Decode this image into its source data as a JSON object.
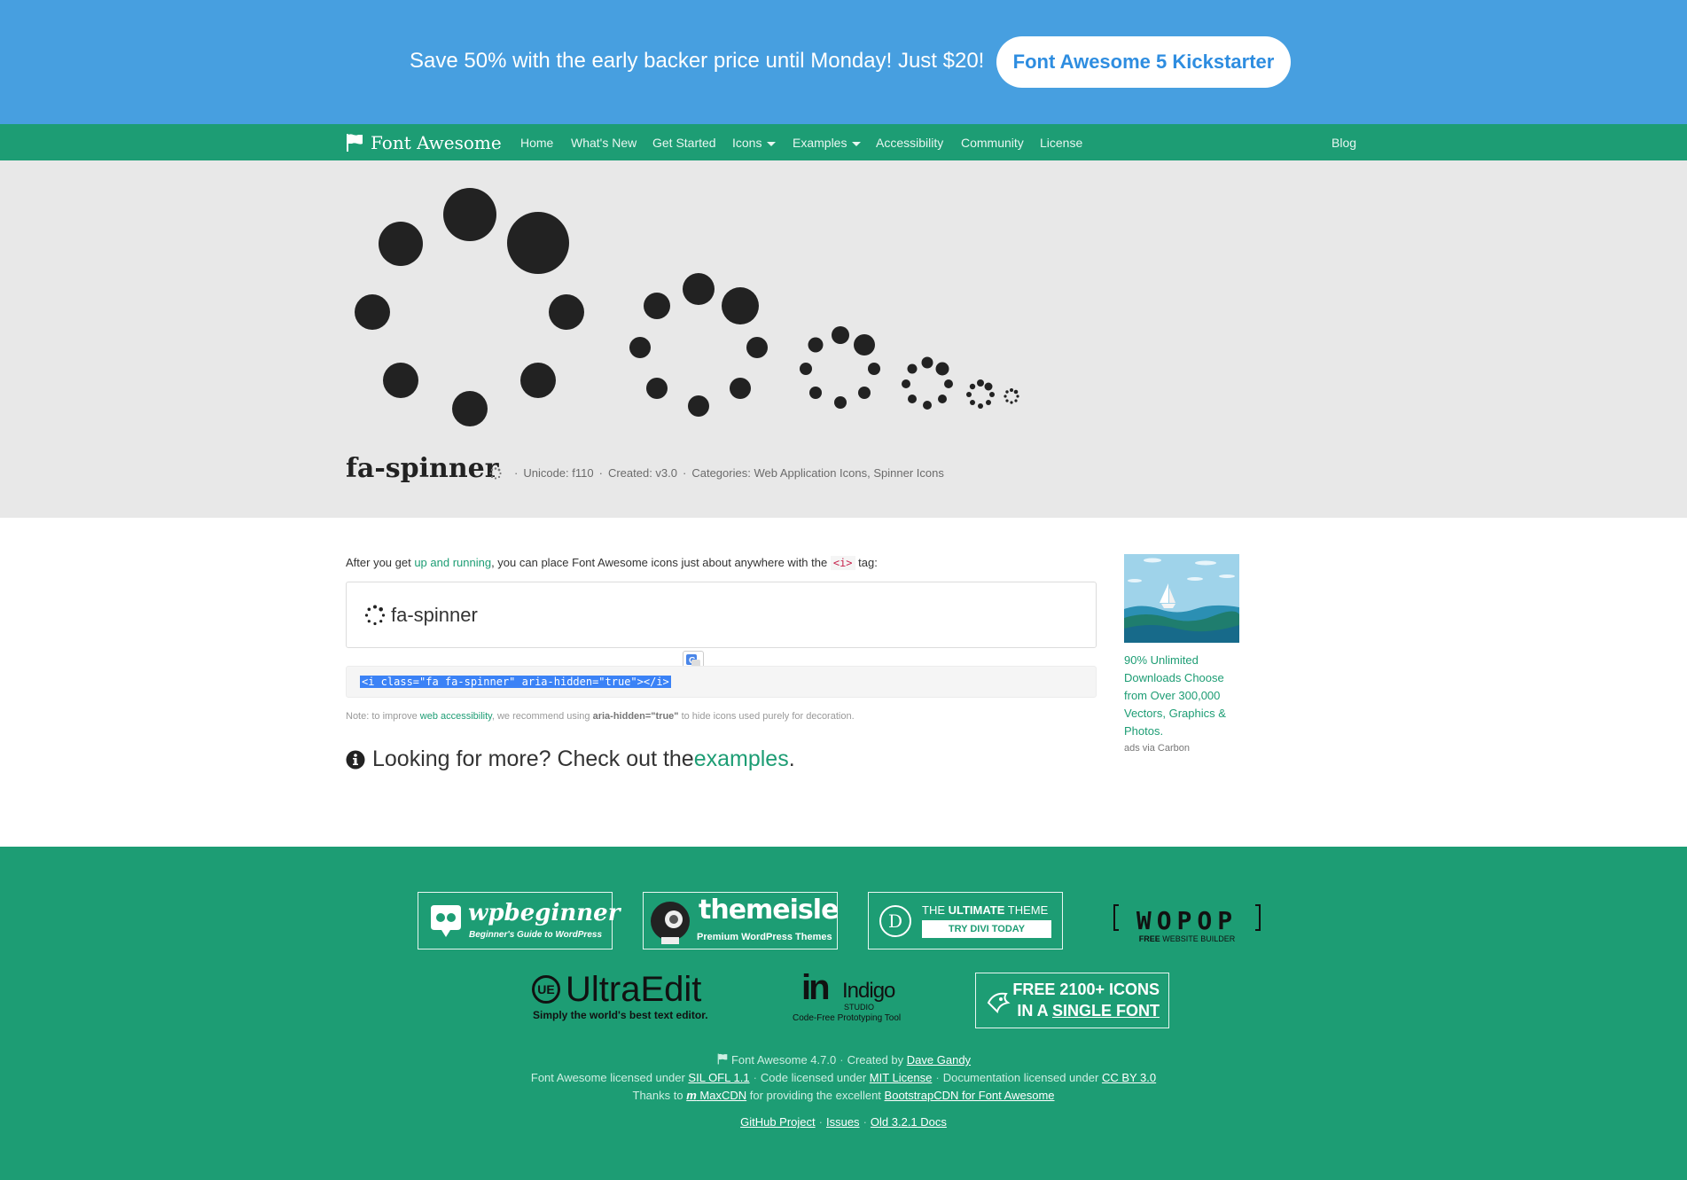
{
  "banner": {
    "text": "Save 50% with the early backer price until Monday! Just $20!",
    "button_label": "Font Awesome 5 Kickstarter"
  },
  "nav": {
    "brand": "Font Awesome",
    "items": [
      "Home",
      "What's New",
      "Get Started",
      "Icons",
      "Examples",
      "Accessibility",
      "Community",
      "License"
    ],
    "blog": "Blog"
  },
  "hero": {
    "icon_name": "fa-spinner",
    "unicode": "Unicode: f110",
    "created": "Created: v3.0",
    "categories_label": "Categories:",
    "category_1": "Web Application Icons",
    "category_2": "Spinner Icons"
  },
  "main": {
    "intro_before": "After you get ",
    "intro_link": "up and running",
    "intro_after": ", you can place Font Awesome icons just about anywhere with the ",
    "intro_tag": "<i>",
    "intro_end": " tag:",
    "demo_label": "fa-spinner",
    "code": "<i class=\"fa fa-spinner\" aria-hidden=\"true\"></i>",
    "note_before": "Note: to improve ",
    "note_link": "web accessibility",
    "note_middle": ", we recommend using ",
    "note_attr": "aria-hidden=\"true\"",
    "note_after": " to hide icons used purely for decoration.",
    "more_before": "Looking for more? Check out the ",
    "more_link": "examples",
    "more_after": "."
  },
  "ad": {
    "text": "90% Unlimited Downloads Choose from Over 300,000 Vectors, Graphics & Photos.",
    "via": "ads via Carbon"
  },
  "sponsors": {
    "wpbeginner_name": "wpbeginner",
    "wpbeginner_tag": "Beginner's Guide to WordPress",
    "themeisle_name": "themeisle",
    "themeisle_tag": "Premium WordPress Themes",
    "divi_line_pre": "THE ",
    "divi_line_bold": "ULTIMATE",
    "divi_line_post": " THEME",
    "divi_button": "TRY DIVI TODAY",
    "divi_letter": "D",
    "wopop_name": "WOPOP",
    "wopop_tag_bold": "FREE",
    "wopop_tag": " WEBSITE BUILDER",
    "ultraedit_name": "UltraEdit",
    "ultraedit_tag": "Simply the world's best text editor.",
    "ultraedit_mark": "UE",
    "indigo_mark": "in",
    "indigo_name": "Indigo",
    "indigo_studio": "STUDIO",
    "indigo_tag": "Code-Free Prototyping Tool",
    "freeicons_line1": "FREE 2100+ ICONS",
    "freeicons_line2_pre": "IN A ",
    "freeicons_line2_u": "SINGLE FONT"
  },
  "footer": {
    "version": "Font Awesome 4.7.0",
    "created_by": "Created by",
    "author": "Dave Gandy",
    "fa_licensed": "Font Awesome licensed under",
    "sil": "SIL OFL 1.1",
    "code_licensed": "Code licensed under",
    "mit": "MIT License",
    "doc_licensed": "Documentation licensed under",
    "cc": "CC BY 3.0",
    "thanks": "Thanks to",
    "maxcdn": "MaxCDN",
    "providing": "for providing the excellent",
    "bootstrapcdn": "BootstrapCDN for Font Awesome",
    "github": "GitHub Project",
    "issues": "Issues",
    "old_docs": "Old 3.2.1 Docs"
  },
  "colors": {
    "primary_green": "#1d9d74",
    "banner_blue": "#479fe0",
    "hero_gray": "#e8e8e8"
  }
}
